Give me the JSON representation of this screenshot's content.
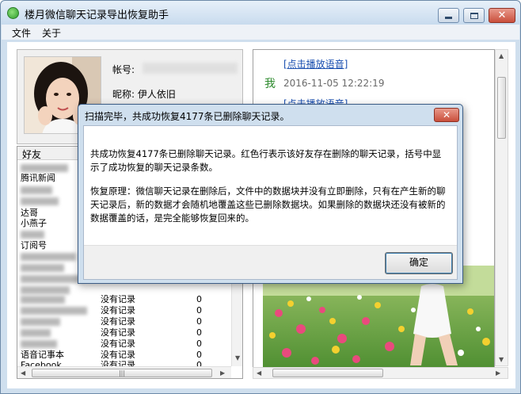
{
  "window": {
    "title": "楼月微信聊天记录导出恢复助手",
    "close_glyph": "✕"
  },
  "menu": {
    "items": [
      {
        "label": "文件"
      },
      {
        "label": "关于"
      }
    ]
  },
  "profile": {
    "account_label": "帐号:",
    "nickname_label": "昵称:",
    "nickname_value": "伊人依旧"
  },
  "friends": {
    "header": "好友",
    "rows": [
      {
        "name": "腾讯新闻",
        "status": "",
        "count": ""
      },
      {
        "name": "达哥",
        "status": "",
        "count": ""
      },
      {
        "name": "小燕子",
        "status": "",
        "count": ""
      },
      {
        "name": "订阅号",
        "status": "",
        "count": ""
      },
      {
        "name": "",
        "status": "没有记录",
        "count": "0"
      },
      {
        "name": "",
        "status": "没有记录",
        "count": "0"
      },
      {
        "name": "",
        "status": "没有记录",
        "count": "0"
      },
      {
        "name": "",
        "status": "没有记录",
        "count": "0"
      },
      {
        "name": "",
        "status": "没有记录",
        "count": "0"
      },
      {
        "name": "",
        "status": "没有记录",
        "count": "0"
      },
      {
        "name": "语音记事本",
        "status": "没有记录",
        "count": "0"
      },
      {
        "name": "Facebook",
        "status": "没有记录",
        "count": "0"
      }
    ],
    "scroll_glyph": "|||"
  },
  "chat": {
    "voice_link_1": "[点击播放语音]",
    "voice_link_2": "[点击播放语音]",
    "sender": "我",
    "timestamp": "2016-11-05 12:22:19"
  },
  "dialog": {
    "title": "扫描完毕，共成功恢复4177条已删除聊天记录。",
    "close_glyph": "✕",
    "paragraph_1": "共成功恢复4177条已删除聊天记录。红色行表示该好友存在删除的聊天记录，括号中显示了成功恢复的聊天记录条数。",
    "paragraph_2": "恢复原理：微信聊天记录在删除后，文件中的数据块并没有立即删除，只有在产生新的聊天记录后，新的数据才会随机地覆盖这些已删除数据块。如果删除的数据块还没有被新的数据覆盖的话，是完全能够恢复回来的。",
    "ok_label": "确定"
  },
  "colors": {
    "link": "#1a4fb0",
    "me_label": "#2d8a2d",
    "timestamp": "#6a6a6a",
    "window_frame": "#cfdfee"
  }
}
